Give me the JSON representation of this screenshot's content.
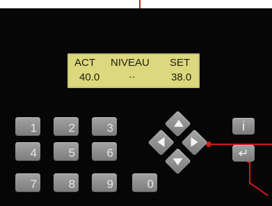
{
  "display": {
    "header": {
      "left": "ACT",
      "middle": "NIVEAU",
      "right": "SET"
    },
    "values": {
      "actual": "40.0",
      "level": "··",
      "setpoint": "38.0"
    }
  },
  "keypad": {
    "digits": [
      "1",
      "2",
      "3",
      "4",
      "5",
      "6",
      "7",
      "8",
      "9",
      "0"
    ]
  },
  "nav": {
    "up": "up-arrow",
    "left": "left-arrow",
    "right": "right-arrow",
    "down": "down-arrow"
  },
  "side": {
    "info_label": "i",
    "enter_label": "↵"
  },
  "colors": {
    "lcd": "#dcd87e",
    "panel": "#060606",
    "indicator": "#d21a1a"
  }
}
